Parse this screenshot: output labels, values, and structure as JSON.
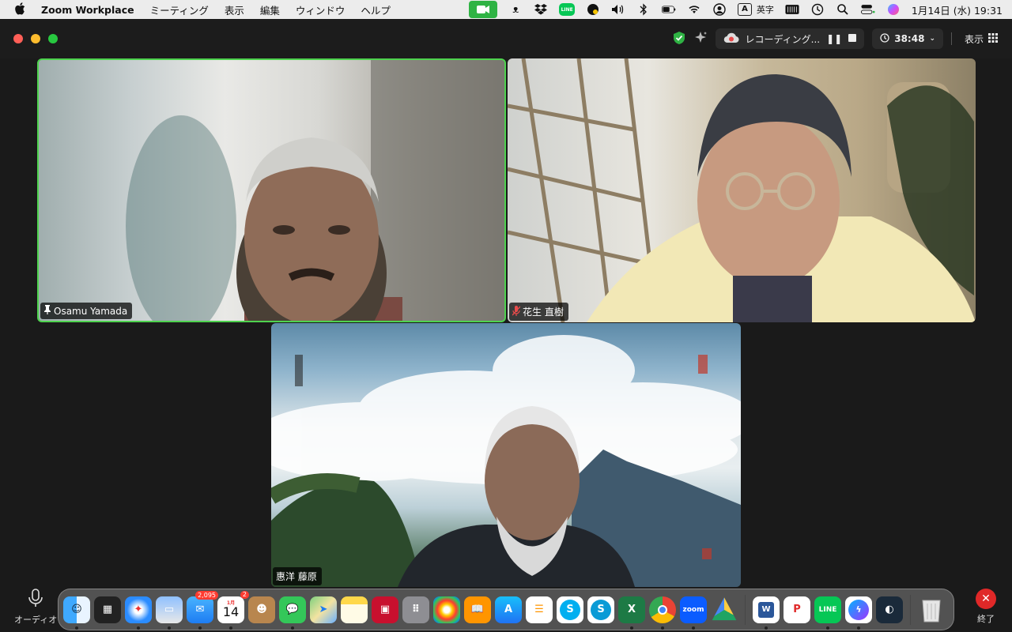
{
  "menubar": {
    "app_name": "Zoom Workplace",
    "menus": [
      "ミーティング",
      "表示",
      "編集",
      "ウィンドウ",
      "ヘルプ"
    ],
    "line_label": "LINE",
    "ime_box": "A",
    "ime_label": "英字",
    "datetime": "1月14日 (水)  19:31"
  },
  "titlebar": {
    "recording_label": "レコーディング...",
    "timer": "38:48",
    "view_label": "表示"
  },
  "tiles": [
    {
      "name": "Osamu Yamada",
      "pinned": true,
      "active_speaker": true
    },
    {
      "name": "花生 直樹",
      "muted": true
    },
    {
      "name": "惠洋 藤原"
    }
  ],
  "controls": {
    "audio_label": "オーディオ",
    "end_label": "終了"
  },
  "dock": {
    "mail_badge": "2,095",
    "calendar_month": "1月",
    "calendar_day": "14",
    "calendar_badge": "2",
    "zoom_label": "zoom",
    "line_label": "LINE"
  },
  "colors": {
    "active_speaker_border": "#4ed34e",
    "zoom_green": "#2fb344",
    "end_red": "#e02828",
    "recording_red": "#e84b4b"
  }
}
